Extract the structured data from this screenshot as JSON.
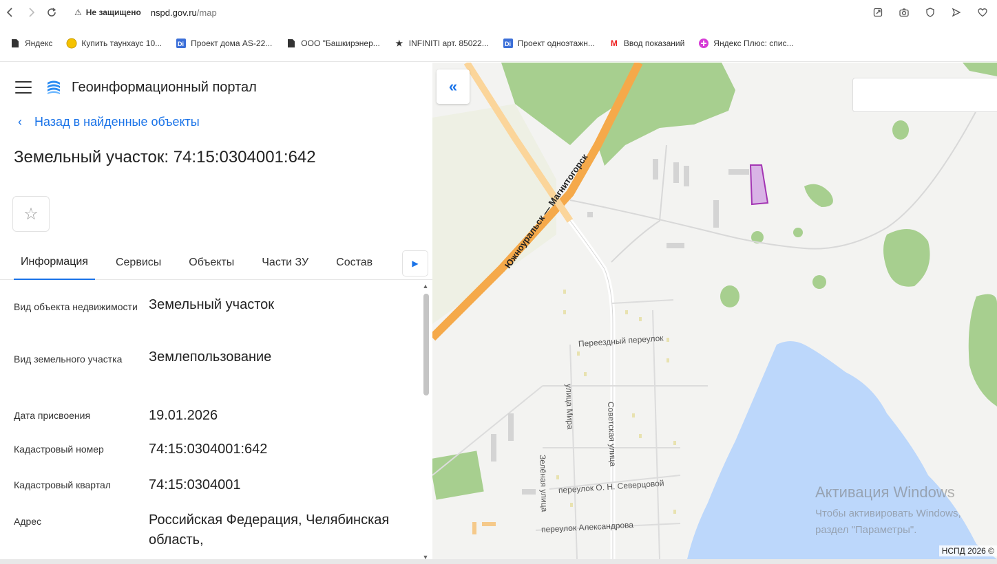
{
  "browser": {
    "insecure_label": "Не защищено",
    "url_host": "nspd.gov.ru",
    "url_path": "/map",
    "bookmarks": [
      {
        "label": "Яндекс",
        "icon": "document-icon"
      },
      {
        "label": "Купить таунхаус 10...",
        "icon": "circle-icon"
      },
      {
        "label": "Проект дома AS-22...",
        "icon": "doc-blue-icon"
      },
      {
        "label": "ООО \"Башкирэнер...",
        "icon": "document-icon"
      },
      {
        "label": "INFINITI арт. 85022...",
        "icon": "star-black-icon"
      },
      {
        "label": "Проект одноэтажн...",
        "icon": "doc-blue-icon"
      },
      {
        "label": "Ввод показаний",
        "icon": "m-red-icon"
      },
      {
        "label": "Яндекс Плюс: спис...",
        "icon": "plus-pink-icon"
      }
    ]
  },
  "panel": {
    "portal_title": "Геоинформационный портал",
    "back_label": "Назад в найденные объекты",
    "page_title": "Земельный участок: 74:15:0304001:642",
    "tabs": [
      {
        "label": "Информация",
        "active": true
      },
      {
        "label": "Сервисы",
        "active": false
      },
      {
        "label": "Объекты",
        "active": false
      },
      {
        "label": "Части ЗУ",
        "active": false
      },
      {
        "label": "Состав",
        "active": false
      }
    ],
    "properties": [
      {
        "key": "Вид объекта недвижимости",
        "value": "Земельный участок"
      },
      {
        "key": "Вид земельного участка",
        "value": "Землепользование"
      },
      {
        "key": "Дата присвоения",
        "value": "19.01.2026"
      },
      {
        "key": "Кадастровый номер",
        "value": "74:15:0304001:642"
      },
      {
        "key": "Кадастровый квартал",
        "value": "74:15:0304001"
      },
      {
        "key": "Адрес",
        "value": "Российская Федерация, Челябинская область,"
      }
    ]
  },
  "map": {
    "road_label": "Южноуральск — Магнитогорск",
    "streets": [
      "Переездный переулок",
      "улица Мира",
      "Советская улица",
      "Зелёная улица",
      "переулок О. Н. Северцовой",
      "переулок Александрова"
    ],
    "watermark_title": "Активация Windows",
    "watermark_line1": "Чтобы активировать Windows,",
    "watermark_line2": "раздел \"Параметры\".",
    "copyright": "НСПД 2026 ©",
    "colors": {
      "water": "#bcd7fb",
      "forest": "#a7cf8f",
      "highway": "#f5a94a",
      "parcel": "#d9b3e6"
    }
  }
}
